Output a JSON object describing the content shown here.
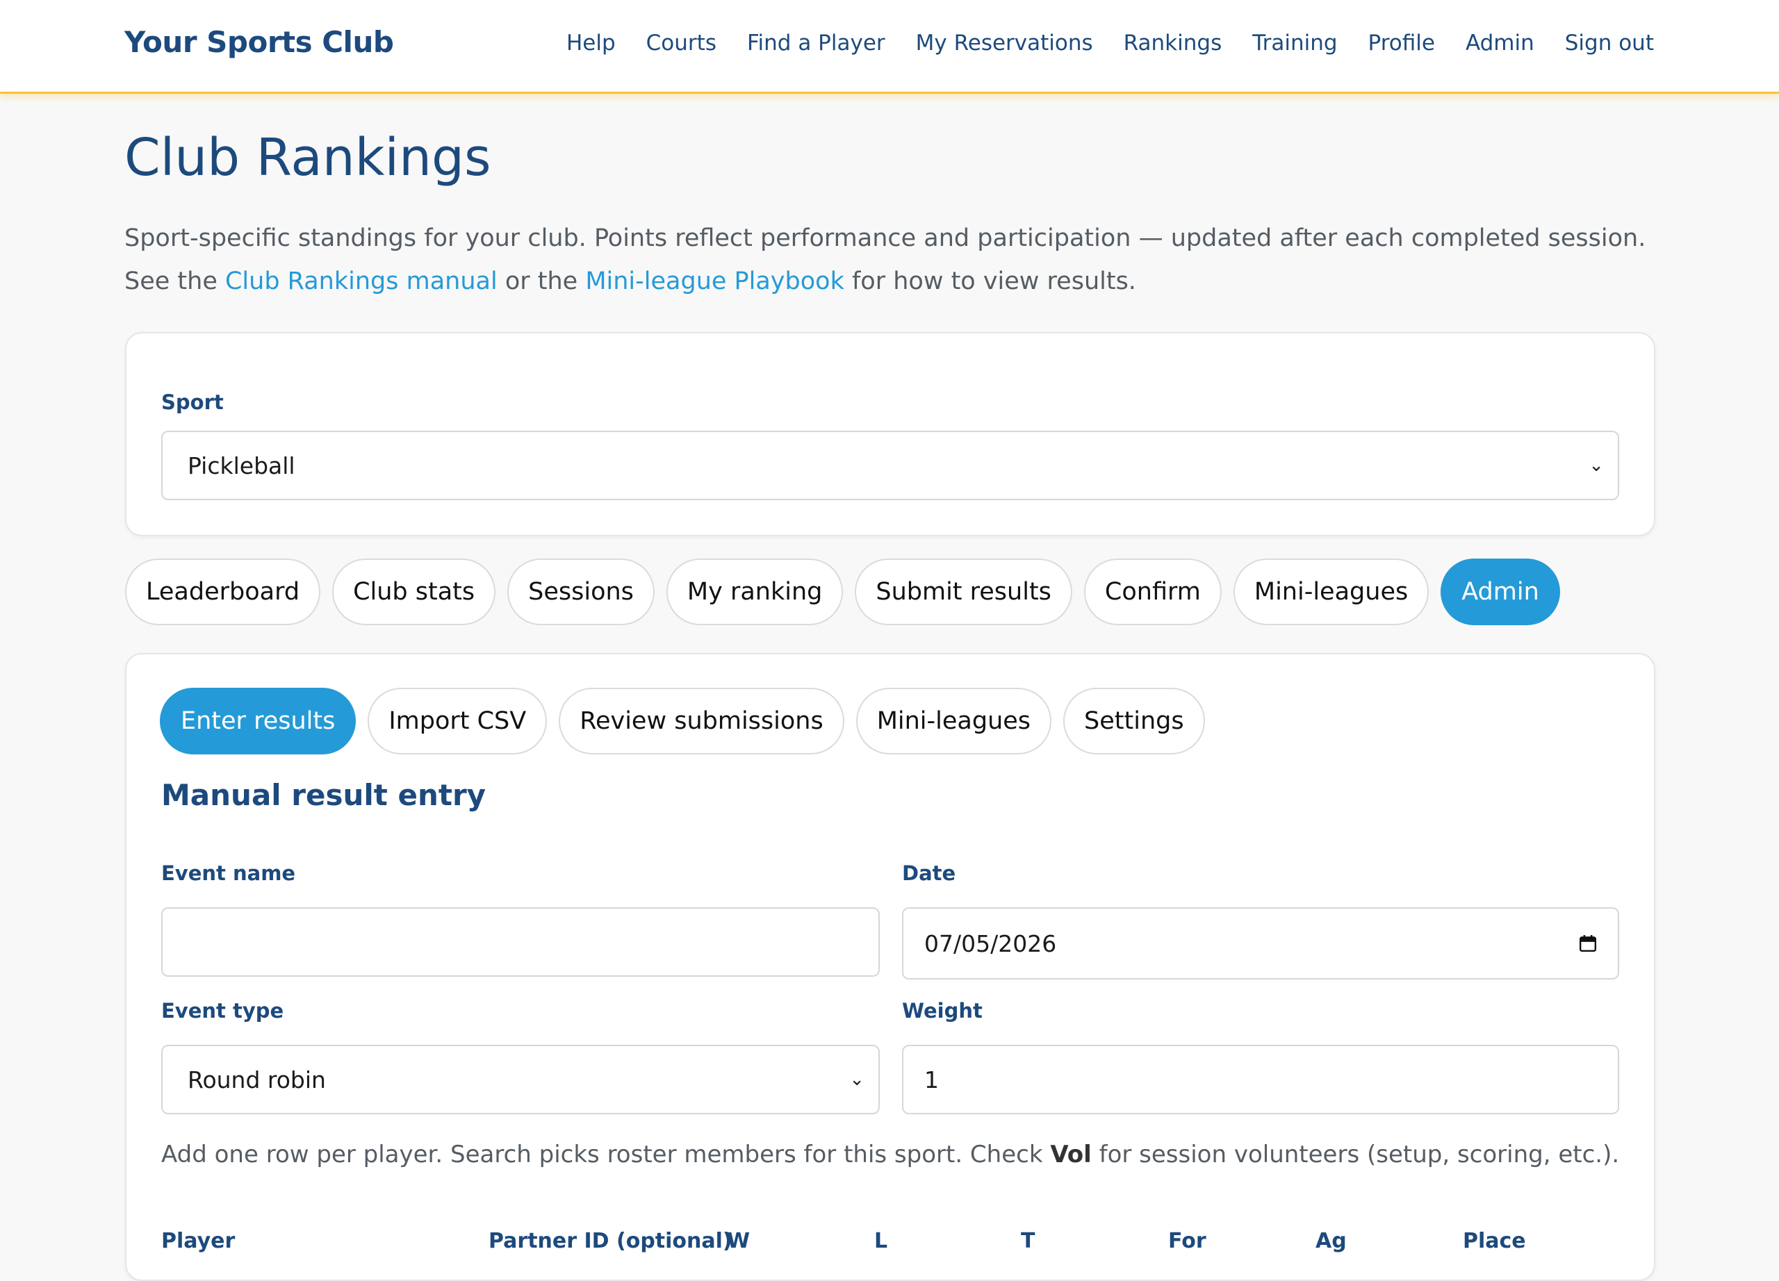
{
  "header": {
    "brand": "Your Sports Club",
    "nav": [
      "Help",
      "Courts",
      "Find a Player",
      "My Reservations",
      "Rankings",
      "Training",
      "Profile",
      "Admin",
      "Sign out"
    ]
  },
  "page": {
    "title": "Club Rankings",
    "intro_text_1": "Sport-specific standings for your club. Points reflect performance and participation — updated after each completed session. See the ",
    "intro_link_1": "Club Rankings manual",
    "intro_text_2": " or the ",
    "intro_link_2": "Mini-league Playbook",
    "intro_text_3": " for how to view results."
  },
  "sport_filter": {
    "label": "Sport",
    "selected": "Pickleball"
  },
  "main_tabs": {
    "items": [
      "Leaderboard",
      "Club stats",
      "Sessions",
      "My ranking",
      "Submit results",
      "Confirm",
      "Mini-leagues",
      "Admin"
    ],
    "active": "Admin"
  },
  "admin_tabs": {
    "items": [
      "Enter results",
      "Import CSV",
      "Review submissions",
      "Mini-leagues",
      "Settings"
    ],
    "active": "Enter results"
  },
  "manual_entry": {
    "title": "Manual result entry",
    "event_name_label": "Event name",
    "event_name_value": "",
    "date_label": "Date",
    "date_value": "07/05/2026",
    "event_type_label": "Event type",
    "event_type_value": "Round robin",
    "weight_label": "Weight",
    "weight_value": "1",
    "hint_text_1": "Add one row per player. Search picks roster members for this sport. Check ",
    "hint_bold": "Vol",
    "hint_text_2": " for session volunteers (setup, scoring, etc.).",
    "columns": [
      "Player",
      "Partner ID (optional)",
      "W",
      "L",
      "T",
      "For",
      "Ag",
      "Place"
    ]
  },
  "colors": {
    "navy": "#1d4a7d",
    "accent_blue": "#259ad8",
    "header_underline": "#f5c33b"
  }
}
